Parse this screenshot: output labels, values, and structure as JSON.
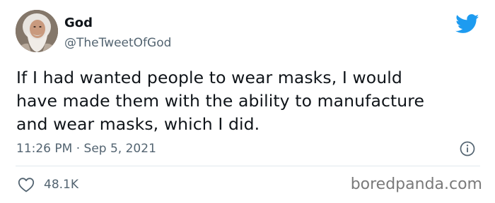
{
  "author": {
    "display_name": "God",
    "handle": "@TheTweetOfGod",
    "avatar_icon": "bearded-man-avatar"
  },
  "tweet": {
    "text_lines": [
      "If I had wanted people to wear masks, I would",
      "have made them with the ability to manufacture",
      "and wear masks, which I did."
    ],
    "time": "11:26 PM",
    "separator": "·",
    "date": "Sep 5, 2021"
  },
  "actions": {
    "like_icon": "heart-outline-icon",
    "like_count": "48.1K",
    "info_icon": "info-circle-icon"
  },
  "brand": {
    "logo_icon": "twitter-bird-icon",
    "logo_color": "#1d9bf0"
  },
  "watermark": "boredpanda.com",
  "colors": {
    "text_primary": "#0f1419",
    "text_secondary": "#536471",
    "divider": "#e1e8ed"
  }
}
